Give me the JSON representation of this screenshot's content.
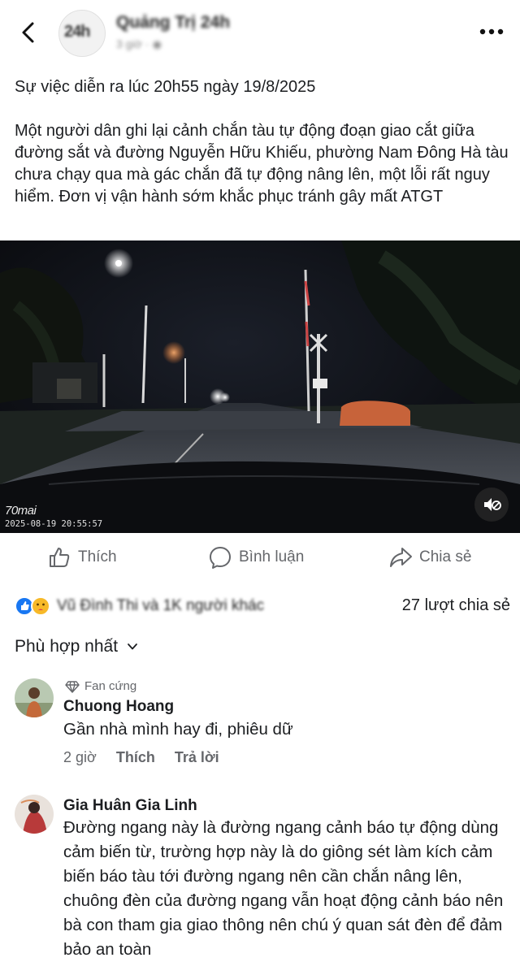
{
  "header": {
    "page_name": "Quảng Trị 24h",
    "page_avatar_text": "24h",
    "page_meta": "3 giờ · ◉"
  },
  "post": {
    "text": "Sự việc diễn ra lúc 20h55 ngày 19/8/2025\n\nMột người dân ghi lại cảnh chắn tàu tự động đoạn giao cắt giữa đường sắt và đường Nguyễn Hữu Khiếu, phường Nam Đông Hà tàu chưa chạy qua mà gác chắn đã tự động nâng lên, một lỗi rất nguy hiểm. Đơn vị vận hành sớm khắc phục tránh gây mất ATGT"
  },
  "video": {
    "watermark_logo": "70mai",
    "timestamp": "2025-08-19 20:55:57"
  },
  "actions": {
    "like": "Thích",
    "comment": "Bình luận",
    "share": "Chia sẻ"
  },
  "reactions": {
    "names": "Vũ Đình Thi và 1K người khác",
    "shares": "27 lượt chia sẻ"
  },
  "sort": {
    "label": "Phù hợp nhất"
  },
  "comments": [
    {
      "badge": "Fan cứng",
      "author": "Chuong Hoang",
      "text": "Gần nhà mình hay đi, phiêu dữ",
      "time": "2 giờ",
      "like": "Thích",
      "reply": "Trả lời"
    },
    {
      "author": "Gia Huân Gia Linh",
      "text": "Đường ngang này là đường ngang cảnh báo tự động dùng cảm biến từ, trường hợp này là do giông sét làm kích cảm biến báo tàu tới đường ngang nên cần chắn nâng lên, chuông đèn của đường ngang vẫn hoạt động cảnh báo nên bà con tham gia giao thông nên chú ý quan sát đèn để đảm bảo an toàn"
    }
  ],
  "colors": {
    "text": "#1c1e21",
    "secondary": "#65676b",
    "video_bg": "#0a0c10",
    "reaction_like": "#1877f2",
    "reaction_care": "#f7b928"
  },
  "icons": [
    "back-arrow-icon",
    "more-icon",
    "mute-icon",
    "like-icon",
    "comment-icon",
    "share-icon",
    "like-reaction-icon",
    "care-reaction-icon",
    "chevron-down-icon",
    "diamond-icon"
  ]
}
